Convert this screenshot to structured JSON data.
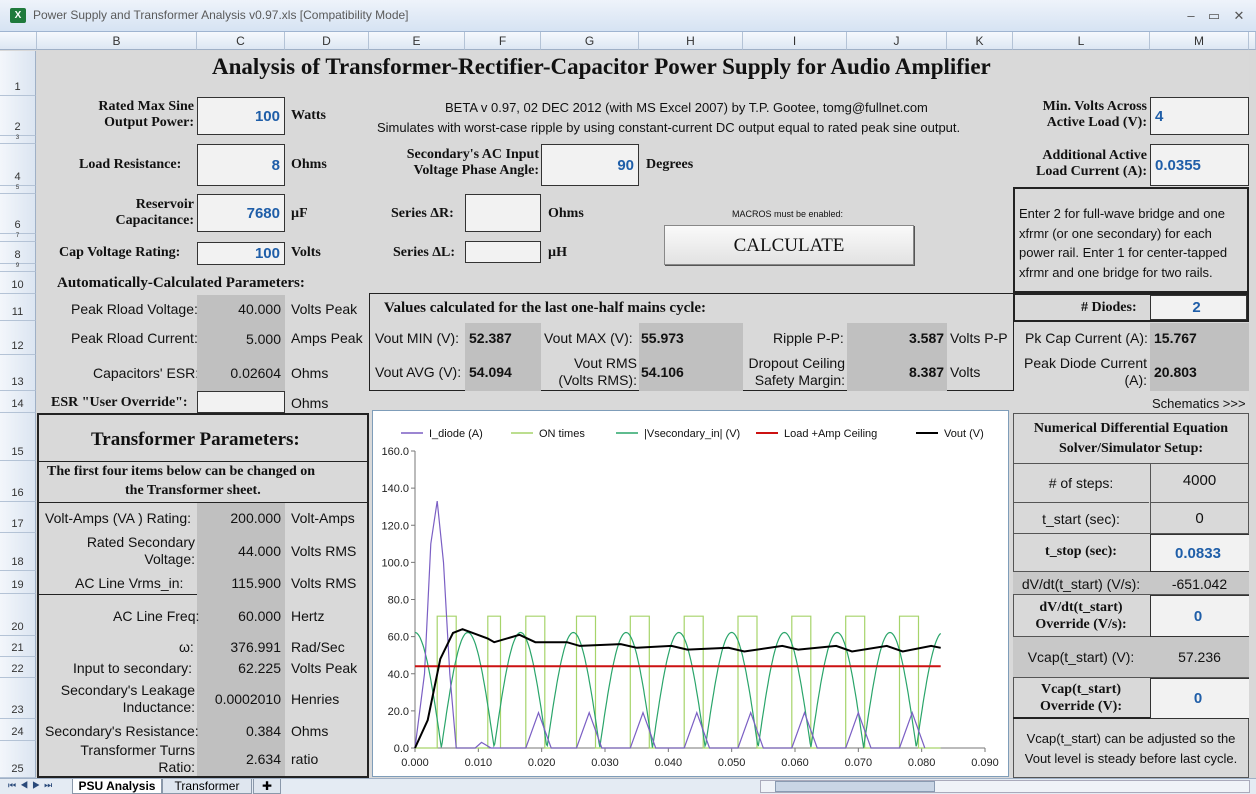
{
  "window": {
    "title": "Power Supply and Transformer Analysis v0.97.xls  [Compatibility Mode]",
    "icon": "excel-icon"
  },
  "columns": [
    "B",
    "C",
    "D",
    "E",
    "F",
    "G",
    "H",
    "I",
    "J",
    "K",
    "L",
    "M"
  ],
  "rows": [
    "1",
    "2",
    "3",
    "4",
    "5",
    "6",
    "7",
    "8",
    "9",
    "10",
    "11",
    "12",
    "13",
    "14",
    "15",
    "16",
    "17",
    "18",
    "19",
    "20",
    "21",
    "22",
    "23",
    "24",
    "25"
  ],
  "sheet": {
    "title": "Analysis of Transformer-Rectifier-Capacitor Power Supply for Audio Amplifier",
    "beta_line1": "BETA v 0.97, 02 DEC 2012 (with MS Excel 2007) by T.P. Gootee, tomg@fullnet.com",
    "beta_line2": "Simulates with worst-case ripple by using constant-current DC output equal to rated peak sine output.",
    "rated_power_label1": "Rated Max Sine",
    "rated_power_label2": "Output Power:",
    "rated_power": "100",
    "rated_power_unit": "Watts",
    "load_res_label": "Load Resistance:",
    "load_res": "8",
    "load_res_unit": "Ohms",
    "reservoir_label1": "Reservoir",
    "reservoir_label2": "Capacitance:",
    "reservoir": "7680",
    "reservoir_unit": "µF",
    "capv_label": "Cap Voltage Rating:",
    "capv": "100",
    "capv_unit": "Volts",
    "phase_label1": "Secondary's AC Input",
    "phase_label2": "Voltage  Phase Angle:",
    "phase": "90",
    "phase_unit": "Degrees",
    "series_r_label": "Series ΔR:",
    "series_r_unit": "Ohms",
    "series_l_label": "Series ΔL:",
    "series_l_unit": "µH",
    "macros_note": "MACROS must be enabled:",
    "calculate": "CALCULATE",
    "minv_label1": "Min. Volts Across",
    "minv_label2": "Active Load (V):",
    "minv": "4",
    "addcur_label1": "Additional Active",
    "addcur_label2": "Load Current  (A):",
    "addcur": "0.0355",
    "diode_note": [
      "Enter 2 for full-wave bridge and one",
      "xfrmr (or one secondary) for each",
      "power rail. Enter 1 for center-tapped",
      "xfrmr and one bridge for two rails."
    ],
    "diodes_label": "# Diodes:",
    "diodes": "2",
    "auto_header": "Automatically-Calculated Parameters:",
    "peak_v_label": "Peak Rload Voltage:",
    "peak_v": "40.000",
    "peak_v_unit": "Volts Peak",
    "peak_i_label": "Peak Rload Current:",
    "peak_i": "5.000",
    "peak_i_unit": "Amps Peak",
    "esr_label": "Capacitors' ESR:",
    "esr": "0.02604",
    "esr_unit": "Ohms",
    "esr_override_label": "ESR \"User Override\":",
    "esr_override_unit": "Ohms",
    "values_header": "Values calculated for the last one-half mains cycle:",
    "vout_min_label": "Vout MIN (V):",
    "vout_min": "52.387",
    "vout_max_label": "Vout MAX (V):",
    "vout_max": "55.973",
    "ripple_label": "Ripple P-P:",
    "ripple": "3.587",
    "ripple_unit": "Volts P-P",
    "pkcap_label": "Pk Cap Current (A):",
    "pkcap": "15.767",
    "vout_avg_label": "Vout AVG (V):",
    "vout_avg": "54.094",
    "vout_rms_label1": "Vout RMS",
    "vout_rms_label2": "(Volts RMS):",
    "vout_rms": "54.106",
    "dropout_label1": "Dropout Ceiling",
    "dropout_label2": "Safety Margin:",
    "dropout": "8.387",
    "dropout_unit": "Volts",
    "pkdiode_label1": "Peak Diode Current",
    "pkdiode_label2": "(A):",
    "pkdiode": "20.803",
    "schematics": "Schematics >>>"
  },
  "transformer": {
    "header": "Transformer Parameters:",
    "note1": "The first four items below can be changed  on",
    "note2": "the Transformer sheet.",
    "rows": [
      {
        "label": "Volt-Amps (VA ) Rating:",
        "label2": "",
        "value": "200.000",
        "unit": "Volt-Amps"
      },
      {
        "label": "Rated Secondary",
        "label2": "Voltage:",
        "value": "44.000",
        "unit": "Volts RMS"
      },
      {
        "label": "AC Line Vrms_in:",
        "label2": "",
        "value": "115.900",
        "unit": "Volts RMS"
      },
      {
        "label": "AC Line Freq:",
        "label2": "",
        "value": "60.000",
        "unit": "Hertz"
      },
      {
        "label": "ω:",
        "label2": "",
        "value": "376.991",
        "unit": "Rad/Sec"
      },
      {
        "label": "Input to secondary:",
        "label2": "",
        "value": "62.225",
        "unit": "Volts Peak"
      },
      {
        "label": "Secondary's Leakage",
        "label2": "Inductance:",
        "value": "0.0002010",
        "unit": "Henries"
      },
      {
        "label": "Secondary's Resistance:",
        "label2": "",
        "value": "0.384",
        "unit": "Ohms"
      },
      {
        "label": "Transformer Turns",
        "label2": "Ratio:",
        "value": "2.634",
        "unit": "ratio"
      }
    ]
  },
  "solver": {
    "header1": "Numerical Differential Equation",
    "header2": "Solver/Simulator Setup:",
    "steps_label": "# of steps:",
    "steps": "4000",
    "tstart_label": "t_start (sec):",
    "tstart": "0",
    "tstop_label": "t_stop (sec):",
    "tstop": "0.0833",
    "dvdt_label": "dV/dt(t_start) (V/s):",
    "dvdt": "-651.042",
    "dvdt_ovr_label1": "dV/dt(t_start)",
    "dvdt_ovr_label2": "Override (V/s):",
    "dvdt_ovr": "0",
    "vcap_label": "Vcap(t_start) (V):",
    "vcap": "57.236",
    "vcap_ovr_label1": "Vcap(t_start)",
    "vcap_ovr_label2": "Override (V):",
    "vcap_ovr": "0",
    "note1": "Vcap(t_start) can be adjusted so the",
    "note2": "Vout level is steady before last cycle."
  },
  "tabs": {
    "active": "PSU Analysis",
    "other": "Transformer"
  },
  "colors": {
    "diode": "#7b5fc4",
    "on_times": "#a6d46a",
    "vsec": "#2aa56a",
    "ceiling": "#cc1111",
    "vout": "#000000"
  },
  "chart_data": {
    "type": "line",
    "xlim": [
      0.0,
      0.09
    ],
    "ylim": [
      0,
      160
    ],
    "xticks": [
      "0.000",
      "0.010",
      "0.020",
      "0.030",
      "0.040",
      "0.050",
      "0.060",
      "0.070",
      "0.080",
      "0.090"
    ],
    "yticks": [
      "0.0",
      "20.0",
      "40.0",
      "60.0",
      "80.0",
      "100.0",
      "120.0",
      "140.0",
      "160.0"
    ],
    "legend_position": "top",
    "series": [
      {
        "name": "I_diode (A)",
        "color": "#7b5fc4",
        "x": [
          0.0,
          0.0015,
          0.0025,
          0.0035,
          0.0045,
          0.0055,
          0.0065,
          0.0095,
          0.0105,
          0.012,
          0.0175,
          0.0195,
          0.0215,
          0.0255,
          0.0275,
          0.0295,
          0.034,
          0.036,
          0.038,
          0.0425,
          0.0445,
          0.0465,
          0.051,
          0.053,
          0.055,
          0.0595,
          0.0615,
          0.0635,
          0.068,
          0.07,
          0.072,
          0.0765,
          0.0785,
          0.0805
        ],
        "y": [
          0,
          40,
          110,
          133,
          100,
          40,
          0,
          0,
          3,
          0,
          0,
          19,
          0,
          0,
          19,
          0,
          0,
          19,
          0,
          0,
          19,
          0,
          0,
          19,
          0,
          0,
          19,
          0,
          0,
          19,
          0,
          0,
          19,
          0
        ]
      },
      {
        "name": "ON times",
        "color": "#a6d46a",
        "x": [
          0.0,
          0.0035,
          0.0035,
          0.0065,
          0.0065,
          0.0115,
          0.0115,
          0.0135,
          0.0135,
          0.0175,
          0.0175,
          0.0205,
          0.0205,
          0.0255,
          0.0255,
          0.0285,
          0.0285,
          0.034,
          0.034,
          0.037,
          0.037,
          0.0425,
          0.0425,
          0.0455,
          0.0455,
          0.051,
          0.051,
          0.054,
          0.054,
          0.0595,
          0.0595,
          0.0625,
          0.0625,
          0.068,
          0.068,
          0.071,
          0.071,
          0.0765,
          0.0765,
          0.0795,
          0.0795,
          0.083
        ],
        "y": [
          0,
          0,
          71,
          71,
          0,
          0,
          71,
          71,
          0,
          0,
          71,
          71,
          0,
          0,
          71,
          71,
          0,
          0,
          71,
          71,
          0,
          0,
          71,
          71,
          0,
          0,
          71,
          71,
          0,
          0,
          71,
          71,
          0,
          0,
          71,
          71,
          0,
          0,
          71,
          71,
          0,
          0
        ]
      },
      {
        "name": "|Vsecondary_in|  (V)",
        "color": "#2aa56a",
        "formula": "62.225*|sin(2*pi*60*t + 90deg)|"
      },
      {
        "name": "Load +Amp Ceiling",
        "color": "#cc1111",
        "x": [
          0.0,
          0.083
        ],
        "y": [
          44,
          44
        ]
      },
      {
        "name": "Vout (V)",
        "color": "#000000",
        "x": [
          0.0,
          0.002,
          0.004,
          0.006,
          0.0075,
          0.0115,
          0.0125,
          0.0165,
          0.019,
          0.024,
          0.026,
          0.0325,
          0.035,
          0.0405,
          0.043,
          0.0495,
          0.052,
          0.058,
          0.0605,
          0.0665,
          0.069,
          0.0745,
          0.077,
          0.0815,
          0.083
        ],
        "y": [
          0,
          15,
          48,
          62,
          64,
          59,
          57,
          61,
          57,
          57,
          55,
          56,
          54,
          55,
          53,
          54,
          52,
          55,
          53,
          55,
          52,
          55,
          52,
          55,
          54
        ]
      }
    ]
  }
}
